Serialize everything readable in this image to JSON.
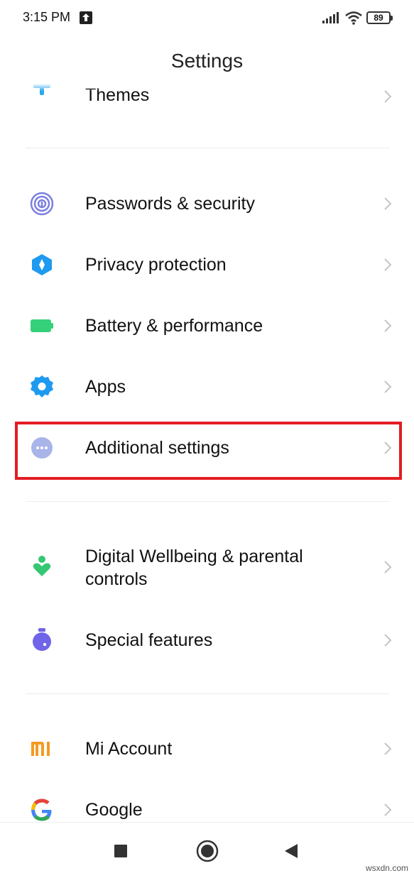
{
  "status_bar": {
    "time": "3:15 PM",
    "battery_level": "89",
    "icons": [
      "upload-notification-icon",
      "signal-icon",
      "wifi-icon",
      "battery-icon"
    ]
  },
  "header": {
    "title": "Settings"
  },
  "items": [
    {
      "label": "Themes",
      "icon": "themes-icon",
      "color": "#2ea8f0"
    },
    {
      "label": "Passwords & security",
      "icon": "fingerprint-icon",
      "color": "#7b7fe0"
    },
    {
      "label": "Privacy protection",
      "icon": "privacy-shield-icon",
      "color": "#1e9af0"
    },
    {
      "label": "Battery & performance",
      "icon": "battery-performance-icon",
      "color": "#35d07a"
    },
    {
      "label": "Apps",
      "icon": "gear-icon",
      "color": "#1e9af0"
    },
    {
      "label": "Additional settings",
      "icon": "more-dots-icon",
      "color": "#a9b4e8"
    },
    {
      "label": "Digital Wellbeing & parental\ncontrols",
      "icon": "wellbeing-icon",
      "color": "#35c772"
    },
    {
      "label": "Special features",
      "icon": "flask-icon",
      "color": "#7064e8"
    },
    {
      "label": "Mi Account",
      "icon": "mi-logo-icon",
      "color": "#f59a23"
    },
    {
      "label": "Google",
      "icon": "google-logo-icon",
      "color": "#4285f4"
    }
  ],
  "highlight": {
    "target": "Additional settings",
    "color": "#e31c24"
  },
  "nav_bar": {
    "buttons": [
      "recents-button",
      "home-button",
      "back-button"
    ]
  },
  "watermark": "wsxdn.com"
}
